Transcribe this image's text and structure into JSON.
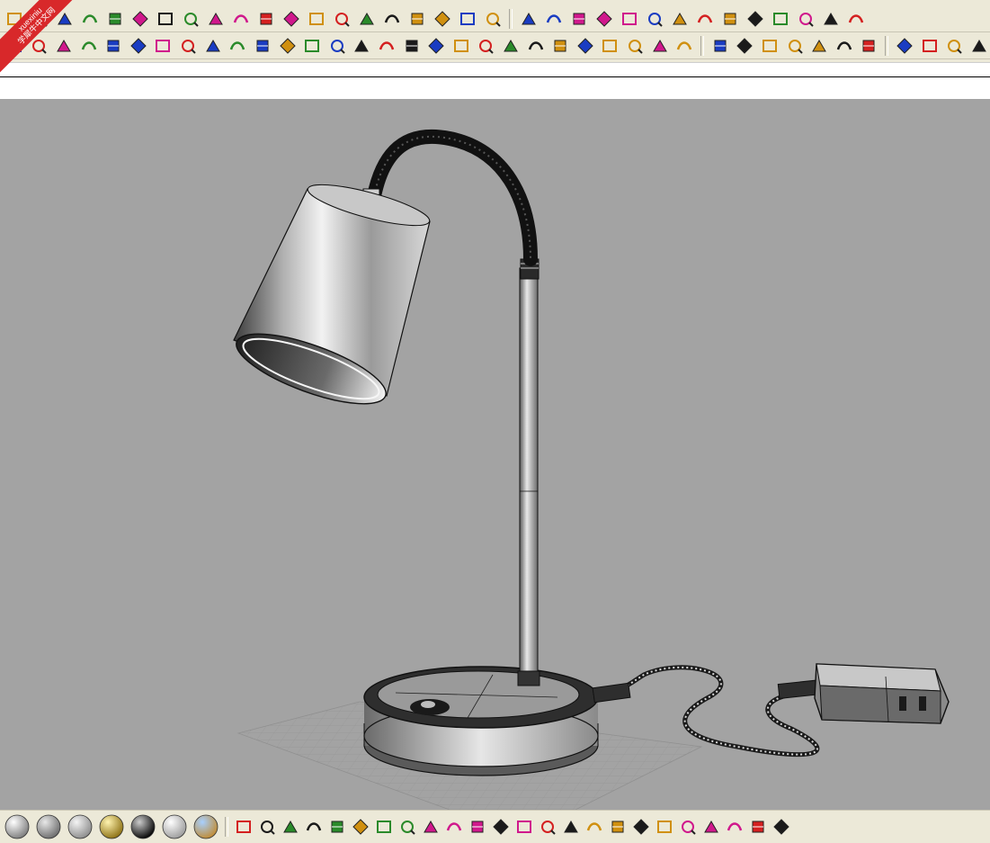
{
  "watermark": {
    "line1": "xuexiniu",
    "line2": "学犀牛中文网"
  },
  "colors": {
    "toolbar_bg": "#ece9d8",
    "viewport_bg": "#a3a3a3",
    "icon_magenta": "#d0188c",
    "icon_red": "#d42020",
    "icon_blue": "#1a3cc2"
  },
  "command": {
    "value": "",
    "placeholder": ""
  },
  "toolbar_row_1": [
    {
      "name": "zoom-window-icon"
    },
    {
      "name": "zoom-extents-icon"
    },
    {
      "name": "zoom-selected-icon"
    },
    {
      "name": "undo-view-icon"
    },
    {
      "name": "four-viewports-icon"
    },
    {
      "name": "car-view-icon"
    },
    {
      "name": "grid-plane-icon"
    },
    {
      "name": "object-snap-icon"
    },
    {
      "name": "point-icon"
    },
    {
      "name": "light-bulb-icon"
    },
    {
      "name": "lock-icon"
    },
    {
      "name": "layer-material-icon"
    },
    {
      "name": "color-wheel-icon"
    },
    {
      "name": "shaded-sphere-icon"
    },
    {
      "name": "wireframe-sphere-icon"
    },
    {
      "name": "render-sphere-icon"
    },
    {
      "name": "analyze-icon"
    },
    {
      "name": "options-gear-icon"
    },
    {
      "name": "dimension-icon"
    },
    {
      "name": "help-icon"
    },
    {
      "name": "red-box-icon"
    },
    {
      "name": "red-cylinder-icon"
    },
    {
      "name": "car-front-icon"
    },
    {
      "name": "car-side-icon"
    },
    {
      "name": "car-top-icon"
    },
    {
      "name": "car-rear-icon"
    },
    {
      "name": "car-perspective-icon"
    },
    {
      "name": "car-explode-icon"
    },
    {
      "name": "printer-icon"
    },
    {
      "name": "open-folder-icon"
    },
    {
      "name": "target-icon"
    },
    {
      "name": "cplane-icon"
    },
    {
      "name": "box-view-icon"
    },
    {
      "name": "align-icon"
    }
  ],
  "toolbar_row_2": [
    {
      "name": "arc-icon"
    },
    {
      "name": "extrude-curve-icon"
    },
    {
      "name": "fillet-edge-icon"
    },
    {
      "name": "box-solid-icon"
    },
    {
      "name": "sweep-icon"
    },
    {
      "name": "loft-icon"
    },
    {
      "name": "check-surface-icon"
    },
    {
      "name": "blend-surface-icon"
    },
    {
      "name": "split-surface-icon"
    },
    {
      "name": "network-surface-icon"
    },
    {
      "name": "patch-icon"
    },
    {
      "name": "rail-revolve-icon"
    },
    {
      "name": "edge-surface-icon"
    },
    {
      "name": "offset-surface-icon"
    },
    {
      "name": "planar-surface-icon"
    },
    {
      "name": "heightfield-icon"
    },
    {
      "name": "unroll-icon"
    },
    {
      "name": "trim-icon"
    },
    {
      "name": "shell-icon"
    },
    {
      "name": "explode-icon"
    },
    {
      "name": "join-icon"
    },
    {
      "name": "rebuild-icon"
    },
    {
      "name": "match-surface-icon"
    },
    {
      "name": "flow-icon"
    },
    {
      "name": "twist-icon"
    },
    {
      "name": "bend-icon"
    },
    {
      "name": "taper-icon"
    },
    {
      "name": "settings-icon"
    },
    {
      "name": "tag-m-icon"
    },
    {
      "name": "tag-o-icon"
    },
    {
      "name": "tag-f-icon"
    },
    {
      "name": "cube-icon"
    },
    {
      "name": "sun-icon"
    },
    {
      "name": "diamond-icon"
    },
    {
      "name": "coin-icon"
    },
    {
      "name": "face-icon"
    },
    {
      "name": "no-entry-icon"
    },
    {
      "name": "face-frame-icon"
    },
    {
      "name": "face-frame-alt-icon"
    }
  ],
  "materials": [
    {
      "name": "chrome-material-icon",
      "base": "#7a7a7a",
      "hi": "#ffffff"
    },
    {
      "name": "steel-material-icon",
      "base": "#6a6a6a",
      "hi": "#e8e8e8"
    },
    {
      "name": "silver-material-icon",
      "base": "#8a8a8a",
      "hi": "#f4f4f4"
    },
    {
      "name": "gold-material-icon",
      "base": "#8a6e10",
      "hi": "#fff3b0"
    },
    {
      "name": "black-plastic-material-icon",
      "base": "#000000",
      "hi": "#cccccc"
    },
    {
      "name": "glass-material-icon",
      "base": "#9a9a9a",
      "hi": "#ffffff"
    },
    {
      "name": "sky-material-icon",
      "base": "#c08a30",
      "hi": "#a8d0ff"
    }
  ],
  "bottom_tools": [
    {
      "name": "polyline-icon"
    },
    {
      "name": "angle-dimension-icon"
    },
    {
      "name": "point-grid-icon"
    },
    {
      "name": "project-icon"
    },
    {
      "name": "blue-box-icon"
    },
    {
      "name": "mirror-icon"
    },
    {
      "name": "diamond-blue-icon"
    },
    {
      "name": "slope-icon"
    },
    {
      "name": "split-icon"
    },
    {
      "name": "curve-on-surface-icon"
    },
    {
      "name": "transform-icon"
    },
    {
      "name": "point-cloud-icon"
    },
    {
      "name": "circle-points-icon"
    },
    {
      "name": "extract-icon"
    },
    {
      "name": "control-points-icon"
    },
    {
      "name": "red-dots-icon"
    },
    {
      "name": "bracket-icon"
    },
    {
      "name": "curve-icon"
    },
    {
      "name": "wedge-icon"
    },
    {
      "name": "ribbon-icon"
    },
    {
      "name": "slash-icon"
    },
    {
      "name": "wave-icon"
    },
    {
      "name": "flag-icon"
    },
    {
      "name": "frame-icon"
    }
  ]
}
